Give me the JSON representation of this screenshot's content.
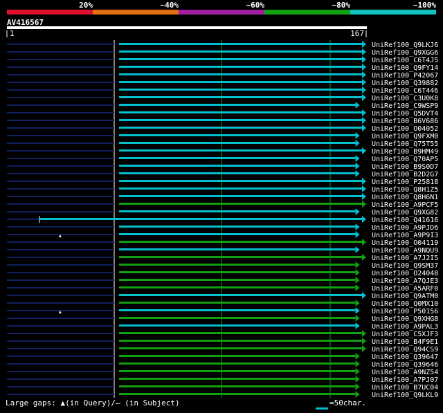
{
  "colors": {
    "background": "#000000",
    "bin_colors": [
      "#e0102f",
      "#e07010",
      "#a020a0",
      "#10a010",
      "#10c0c0"
    ],
    "hit_high": "#00c0d0",
    "hit_mid": "#10a010",
    "guide": "#10a010",
    "query_bar": "#ffffff",
    "dim_lead": "#102060"
  },
  "identity_bins": {
    "labels": [
      "20%",
      "~40%",
      "~60%",
      "~80%",
      "~100%"
    ]
  },
  "query": {
    "name": "AV416567",
    "start_label": "1",
    "end_label": "167"
  },
  "legend": {
    "text": "Large gaps: ▲(in Query)/— (in Subject)",
    "scale_label": "=50char."
  },
  "chart_data": {
    "type": "alignment-track",
    "query_length": 167,
    "title": "AV416567",
    "hits": [
      {
        "name": "UniRef100_Q9LKJ6",
        "end": 167,
        "class": "high"
      },
      {
        "name": "UniRef100_Q9XGG6",
        "end": 167,
        "class": "high"
      },
      {
        "name": "UniRef100_C6T4J5",
        "end": 167,
        "class": "high"
      },
      {
        "name": "UniRef100_Q9FY14",
        "end": 167,
        "class": "high"
      },
      {
        "name": "UniRef100_P42067",
        "end": 167,
        "class": "high"
      },
      {
        "name": "UniRef100_Q39882",
        "end": 167,
        "class": "high"
      },
      {
        "name": "UniRef100_C6T446",
        "end": 167,
        "class": "high"
      },
      {
        "name": "UniRef100_C3U0K8",
        "end": 167,
        "class": "high"
      },
      {
        "name": "UniRef100_C9WSP9",
        "end": 164,
        "class": "high"
      },
      {
        "name": "UniRef100_Q5DVT4",
        "end": 167,
        "class": "high"
      },
      {
        "name": "UniRef100_B6V686",
        "end": 167,
        "class": "high"
      },
      {
        "name": "UniRef100_O04052",
        "end": 167,
        "class": "high"
      },
      {
        "name": "UniRef100_Q9FXM0",
        "end": 164,
        "class": "high"
      },
      {
        "name": "UniRef100_Q75T55",
        "end": 164,
        "class": "high"
      },
      {
        "name": "UniRef100_B9HM49",
        "end": 167,
        "class": "high"
      },
      {
        "name": "UniRef100_Q70AP5",
        "end": 164,
        "class": "high"
      },
      {
        "name": "UniRef100_B9S0D7",
        "end": 164,
        "class": "high"
      },
      {
        "name": "UniRef100_B2D2G7",
        "end": 164,
        "class": "high"
      },
      {
        "name": "UniRef100_P25818",
        "end": 167,
        "class": "high"
      },
      {
        "name": "UniRef100_Q8H1Z5",
        "end": 167,
        "class": "high"
      },
      {
        "name": "UniRef100_Q8H6N1",
        "end": 167,
        "class": "high"
      },
      {
        "name": "UniRef100_A9PCF5",
        "end": 167,
        "class": "mid"
      },
      {
        "name": "UniRef100_Q9XG82",
        "end": 164,
        "class": "high"
      },
      {
        "name": "UniRef100_Q41616",
        "end": 167,
        "class": "high",
        "start": 16
      },
      {
        "name": "UniRef100_A9PJD6",
        "end": 164,
        "class": "high"
      },
      {
        "name": "UniRef100_A9P9I3",
        "end": 164,
        "class": "high"
      },
      {
        "name": "UniRef100_O04119",
        "end": 167,
        "class": "mid",
        "query_gap_at": 16
      },
      {
        "name": "UniRef100_A9NQU9",
        "end": 164,
        "class": "high"
      },
      {
        "name": "UniRef100_A7J2I5",
        "end": 167,
        "class": "mid"
      },
      {
        "name": "UniRef100_Q9SM37",
        "end": 164,
        "class": "mid"
      },
      {
        "name": "UniRef100_O24048",
        "end": 164,
        "class": "mid"
      },
      {
        "name": "UniRef100_A7QJE3",
        "end": 164,
        "class": "mid"
      },
      {
        "name": "UniRef100_A5ARF0",
        "end": 164,
        "class": "mid"
      },
      {
        "name": "UniRef100_Q9ATM0",
        "end": 167,
        "class": "high"
      },
      {
        "name": "UniRef100_Q0MX10",
        "end": 164,
        "class": "mid"
      },
      {
        "name": "UniRef100_P50156",
        "end": 164,
        "class": "high"
      },
      {
        "name": "UniRef100_Q9XHG8",
        "end": 164,
        "class": "mid",
        "query_gap_at": 16
      },
      {
        "name": "UniRef100_A9PAL3",
        "end": 164,
        "class": "high"
      },
      {
        "name": "UniRef100_C5XJF3",
        "end": 167,
        "class": "mid"
      },
      {
        "name": "UniRef100_B4F9E1",
        "end": 167,
        "class": "mid"
      },
      {
        "name": "UniRef100_Q94CS9",
        "end": 167,
        "class": "mid"
      },
      {
        "name": "UniRef100_Q39647",
        "end": 164,
        "class": "mid"
      },
      {
        "name": "UniRef100_Q39646",
        "end": 164,
        "class": "mid"
      },
      {
        "name": "UniRef100_A9NZ54",
        "end": 164,
        "class": "mid"
      },
      {
        "name": "UniRef100_A7PJ07",
        "end": 164,
        "class": "mid"
      },
      {
        "name": "UniRef100_B7UC04",
        "end": 164,
        "class": "mid"
      },
      {
        "name": "UniRef100_Q9LKL9",
        "end": 164,
        "class": "mid"
      }
    ]
  }
}
